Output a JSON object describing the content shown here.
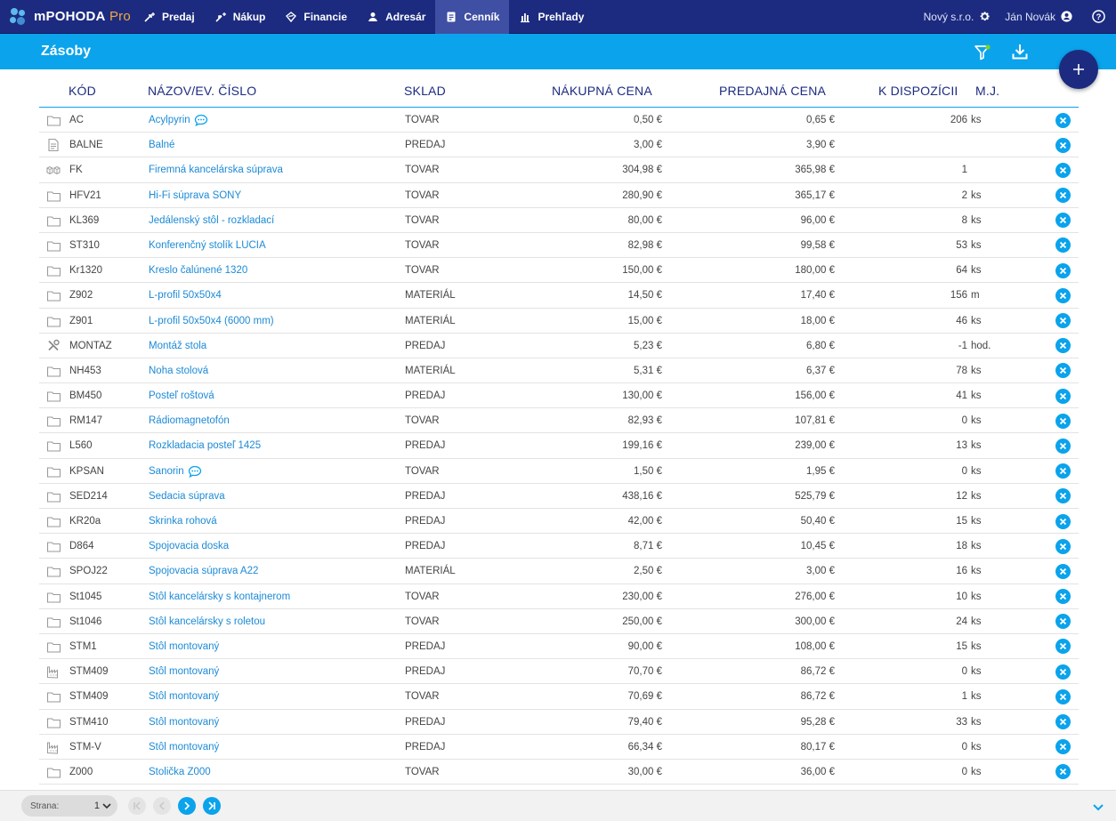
{
  "app": {
    "name": "mPOHODA",
    "edition": "Pro"
  },
  "nav": [
    {
      "label": "Predaj",
      "icon": "sales-icon",
      "active": false
    },
    {
      "label": "Nákup",
      "icon": "purchase-icon",
      "active": false
    },
    {
      "label": "Financie",
      "icon": "finance-icon",
      "active": false
    },
    {
      "label": "Adresár",
      "icon": "address-book-icon",
      "active": false
    },
    {
      "label": "Cenník",
      "icon": "price-list-icon",
      "active": true
    },
    {
      "label": "Prehľady",
      "icon": "reports-icon",
      "active": false
    }
  ],
  "top_right": {
    "company": "Nový s.r.o.",
    "user": "Ján Novák"
  },
  "page": {
    "title": "Zásoby"
  },
  "table": {
    "headers": {
      "code": "KÓD",
      "name": "NÁZOV/EV. ČÍSLO",
      "store": "SKLAD",
      "buy": "NÁKUPNÁ CENA",
      "sell": "PREDAJNÁ CENA",
      "avail": "K DISPOZÍCII",
      "unit": "M.J."
    },
    "rows": [
      {
        "icon": "folder-icon",
        "code": "AC",
        "name": "Acylpyrin",
        "note": true,
        "store": "TOVAR",
        "buy": "0,50 €",
        "sell": "0,65 €",
        "avail": "206",
        "unit": "ks"
      },
      {
        "icon": "document-icon",
        "code": "BALNE",
        "name": "Balné",
        "note": false,
        "store": "PREDAJ",
        "buy": "3,00 €",
        "sell": "3,90 €",
        "avail": "",
        "unit": ""
      },
      {
        "icon": "boxes-icon",
        "code": "FK",
        "name": "Firemná kancelárska súprava",
        "note": false,
        "store": "TOVAR",
        "buy": "304,98 €",
        "sell": "365,98 €",
        "avail": "1",
        "unit": ""
      },
      {
        "icon": "folder-icon",
        "code": "HFV21",
        "name": "Hi-Fi súprava SONY",
        "note": false,
        "store": "TOVAR",
        "buy": "280,90 €",
        "sell": "365,17 €",
        "avail": "2",
        "unit": "ks"
      },
      {
        "icon": "folder-icon",
        "code": "KL369",
        "name": "Jedálenský stôl - rozkladací",
        "note": false,
        "store": "TOVAR",
        "buy": "80,00 €",
        "sell": "96,00 €",
        "avail": "8",
        "unit": "ks"
      },
      {
        "icon": "folder-icon",
        "code": "ST310",
        "name": "Konferenčný stolík LUCIA",
        "note": false,
        "store": "TOVAR",
        "buy": "82,98 €",
        "sell": "99,58 €",
        "avail": "53",
        "unit": "ks"
      },
      {
        "icon": "folder-icon",
        "code": "Kr1320",
        "name": "Kreslo čalúnené 1320",
        "note": false,
        "store": "TOVAR",
        "buy": "150,00 €",
        "sell": "180,00 €",
        "avail": "64",
        "unit": "ks"
      },
      {
        "icon": "folder-icon",
        "code": "Z902",
        "name": "L-profil 50x50x4",
        "note": false,
        "store": "MATERIÁL",
        "buy": "14,50 €",
        "sell": "17,40 €",
        "avail": "156",
        "unit": "m"
      },
      {
        "icon": "folder-icon",
        "code": "Z901",
        "name": "L-profil 50x50x4 (6000 mm)",
        "note": false,
        "store": "MATERIÁL",
        "buy": "15,00 €",
        "sell": "18,00 €",
        "avail": "46",
        "unit": "ks"
      },
      {
        "icon": "tools-icon",
        "code": "MONTAZ",
        "name": "Montáž stola",
        "note": false,
        "store": "PREDAJ",
        "buy": "5,23 €",
        "sell": "6,80 €",
        "avail": "-1",
        "unit": "hod."
      },
      {
        "icon": "folder-icon",
        "code": "NH453",
        "name": "Noha stolová",
        "note": false,
        "store": "MATERIÁL",
        "buy": "5,31 €",
        "sell": "6,37 €",
        "avail": "78",
        "unit": "ks"
      },
      {
        "icon": "folder-icon",
        "code": "BM450",
        "name": "Posteľ roštová",
        "note": false,
        "store": "PREDAJ",
        "buy": "130,00 €",
        "sell": "156,00 €",
        "avail": "41",
        "unit": "ks"
      },
      {
        "icon": "folder-icon",
        "code": "RM147",
        "name": "Rádiomagnetofón",
        "note": false,
        "store": "TOVAR",
        "buy": "82,93 €",
        "sell": "107,81 €",
        "avail": "0",
        "unit": "ks"
      },
      {
        "icon": "folder-icon",
        "code": "L560",
        "name": "Rozkladacia posteľ 1425",
        "note": false,
        "store": "PREDAJ",
        "buy": "199,16 €",
        "sell": "239,00 €",
        "avail": "13",
        "unit": "ks"
      },
      {
        "icon": "folder-icon",
        "code": "KPSAN",
        "name": "Sanorin",
        "note": true,
        "store": "TOVAR",
        "buy": "1,50 €",
        "sell": "1,95 €",
        "avail": "0",
        "unit": "ks"
      },
      {
        "icon": "folder-icon",
        "code": "SED214",
        "name": "Sedacia súprava",
        "note": false,
        "store": "PREDAJ",
        "buy": "438,16 €",
        "sell": "525,79 €",
        "avail": "12",
        "unit": "ks"
      },
      {
        "icon": "folder-icon",
        "code": "KR20a",
        "name": "Skrinka rohová",
        "note": false,
        "store": "PREDAJ",
        "buy": "42,00 €",
        "sell": "50,40 €",
        "avail": "15",
        "unit": "ks"
      },
      {
        "icon": "folder-icon",
        "code": "D864",
        "name": "Spojovacia doska",
        "note": false,
        "store": "PREDAJ",
        "buy": "8,71 €",
        "sell": "10,45 €",
        "avail": "18",
        "unit": "ks"
      },
      {
        "icon": "folder-icon",
        "code": "SPOJ22",
        "name": "Spojovacia súprava A22",
        "note": false,
        "store": "MATERIÁL",
        "buy": "2,50 €",
        "sell": "3,00 €",
        "avail": "16",
        "unit": "ks"
      },
      {
        "icon": "folder-icon",
        "code": "St1045",
        "name": "Stôl kancelársky s kontajnerom",
        "note": false,
        "store": "TOVAR",
        "buy": "230,00 €",
        "sell": "276,00 €",
        "avail": "10",
        "unit": "ks"
      },
      {
        "icon": "folder-icon",
        "code": "St1046",
        "name": "Stôl kancelársky s roletou",
        "note": false,
        "store": "TOVAR",
        "buy": "250,00 €",
        "sell": "300,00 €",
        "avail": "24",
        "unit": "ks"
      },
      {
        "icon": "folder-icon",
        "code": "STM1",
        "name": "Stôl montovaný",
        "note": false,
        "store": "PREDAJ",
        "buy": "90,00 €",
        "sell": "108,00 €",
        "avail": "15",
        "unit": "ks"
      },
      {
        "icon": "factory-icon",
        "code": "STM409",
        "name": "Stôl montovaný",
        "note": false,
        "store": "PREDAJ",
        "buy": "70,70 €",
        "sell": "86,72 €",
        "avail": "0",
        "unit": "ks"
      },
      {
        "icon": "folder-icon",
        "code": "STM409",
        "name": "Stôl montovaný",
        "note": false,
        "store": "TOVAR",
        "buy": "70,69 €",
        "sell": "86,72 €",
        "avail": "1",
        "unit": "ks"
      },
      {
        "icon": "folder-icon",
        "code": "STM410",
        "name": "Stôl montovaný",
        "note": false,
        "store": "PREDAJ",
        "buy": "79,40 €",
        "sell": "95,28 €",
        "avail": "33",
        "unit": "ks"
      },
      {
        "icon": "factory-icon",
        "code": "STM-V",
        "name": "Stôl montovaný",
        "note": false,
        "store": "PREDAJ",
        "buy": "66,34 €",
        "sell": "80,17 €",
        "avail": "0",
        "unit": "ks"
      },
      {
        "icon": "folder-icon",
        "code": "Z000",
        "name": "Stolička Z000",
        "note": false,
        "store": "TOVAR",
        "buy": "30,00 €",
        "sell": "36,00 €",
        "avail": "0",
        "unit": "ks"
      }
    ]
  },
  "pager": {
    "label": "Strana:",
    "page": "1"
  },
  "colors": {
    "navy": "#1c2b80",
    "accent": "#0aa3ec",
    "link": "#1c8ad6",
    "filter_dot": "#7ed321"
  }
}
